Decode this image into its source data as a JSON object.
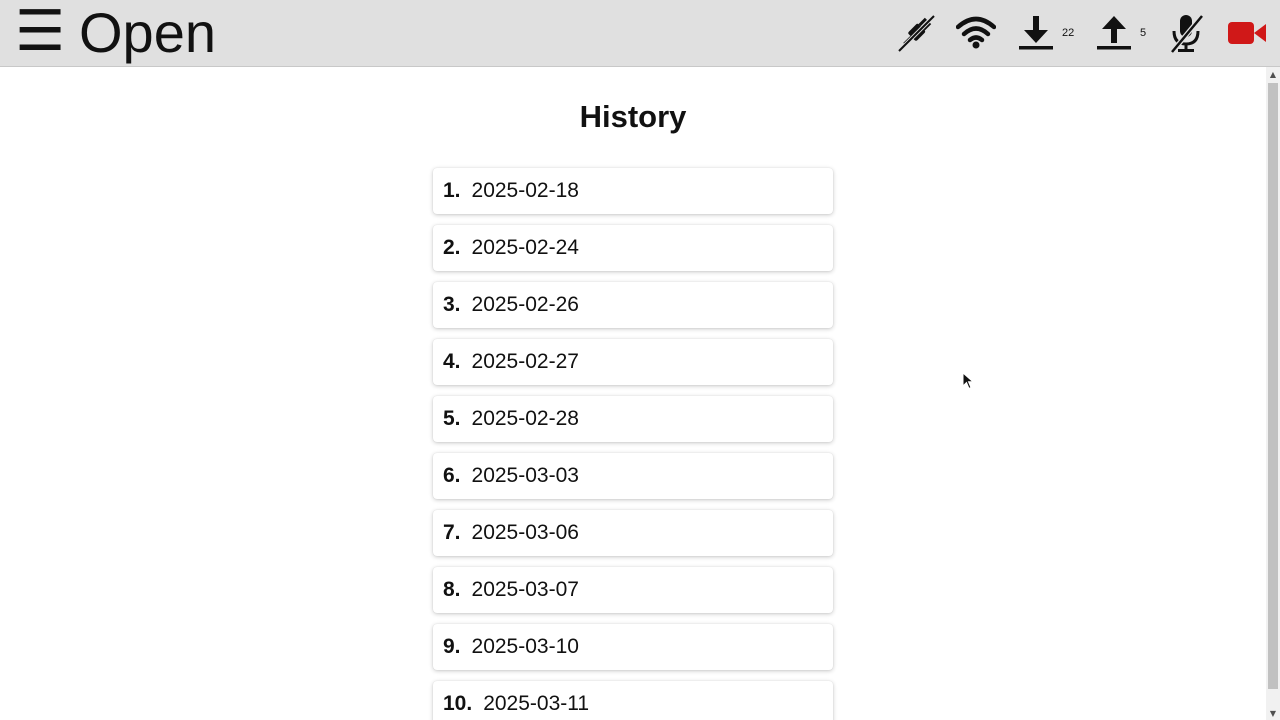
{
  "topbar": {
    "menu_glyph": "☰",
    "title": "Open",
    "icons": [
      {
        "name": "plug-disconnected-icon"
      },
      {
        "name": "wifi-icon"
      },
      {
        "name": "download-icon",
        "count": "22"
      },
      {
        "name": "upload-icon",
        "count": "5"
      },
      {
        "name": "microphone-muted-icon"
      },
      {
        "name": "video-camera-icon",
        "color": "#d01818"
      }
    ]
  },
  "main": {
    "heading": "History",
    "items": [
      {
        "num": "1.",
        "date": "2025-02-18"
      },
      {
        "num": "2.",
        "date": "2025-02-24"
      },
      {
        "num": "3.",
        "date": "2025-02-26"
      },
      {
        "num": "4.",
        "date": "2025-02-27"
      },
      {
        "num": "5.",
        "date": "2025-02-28"
      },
      {
        "num": "6.",
        "date": "2025-03-03"
      },
      {
        "num": "7.",
        "date": "2025-03-06"
      },
      {
        "num": "8.",
        "date": "2025-03-07"
      },
      {
        "num": "9.",
        "date": "2025-03-10"
      },
      {
        "num": "10.",
        "date": "2025-03-11"
      }
    ]
  },
  "scrollbar": {
    "up_glyph": "▲",
    "down_glyph": "▼"
  }
}
